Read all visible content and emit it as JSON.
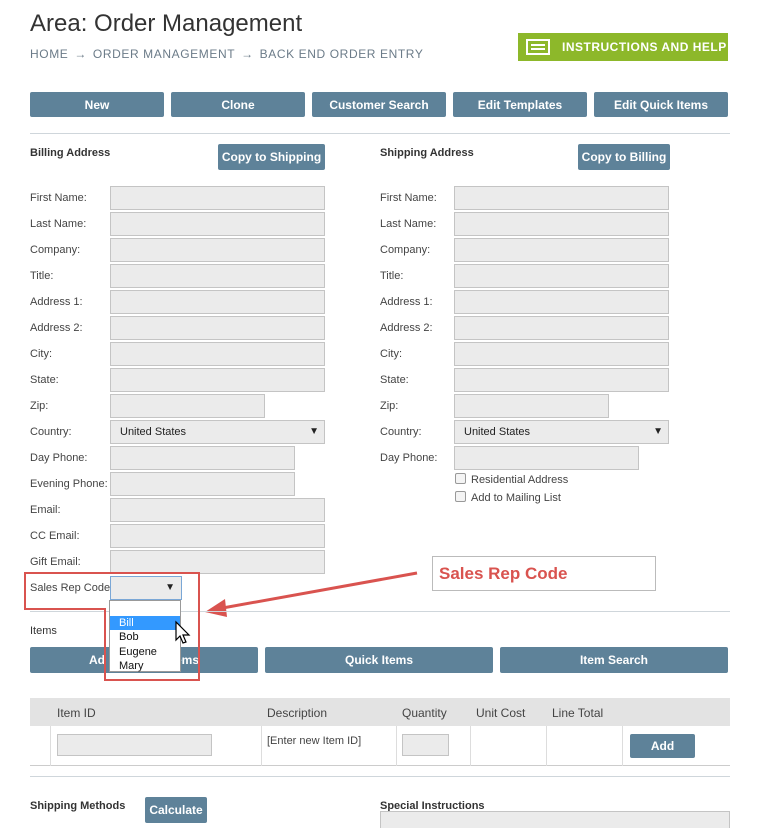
{
  "header": {
    "title": "Area: Order Management",
    "breadcrumb": [
      "HOME",
      "ORDER MANAGEMENT",
      "BACK END ORDER ENTRY"
    ],
    "breadcrumb_sep": "→",
    "help_label": "INSTRUCTIONS AND HELP"
  },
  "toolbar": {
    "new": "New",
    "clone": "Clone",
    "customer_search": "Customer Search",
    "edit_templates": "Edit Templates",
    "edit_quick_items": "Edit Quick Items"
  },
  "billing": {
    "heading": "Billing Address",
    "copy_btn": "Copy to Shipping",
    "labels": {
      "first_name": "First Name:",
      "last_name": "Last Name:",
      "company": "Company:",
      "title": "Title:",
      "address1": "Address 1:",
      "address2": "Address 2:",
      "city": "City:",
      "state": "State:",
      "zip": "Zip:",
      "country": "Country:",
      "day_phone": "Day Phone:",
      "evening_phone": "Evening Phone:",
      "email": "Email:",
      "cc_email": "CC Email:",
      "gift_email": "Gift Email:",
      "sales_rep": "Sales Rep Code"
    },
    "country_value": "United States"
  },
  "shipping": {
    "heading": "Shipping Address",
    "copy_btn": "Copy to Billing",
    "labels": {
      "first_name": "First Name:",
      "last_name": "Last Name:",
      "company": "Company:",
      "title": "Title:",
      "address1": "Address 1:",
      "address2": "Address 2:",
      "city": "City:",
      "state": "State:",
      "zip": "Zip:",
      "country": "Country:",
      "day_phone": "Day Phone:"
    },
    "country_value": "United States",
    "residential": "Residential Address",
    "mailing": "Add to Mailing List"
  },
  "sales_rep_dropdown": {
    "options": [
      "",
      "Bill",
      "Bob",
      "Eugene",
      "Mary"
    ],
    "highlighted": "Bill"
  },
  "annotation": {
    "callout": "Sales Rep Code",
    "accent": "#d9534f"
  },
  "items": {
    "heading": "Items",
    "add_items": "Add Items",
    "add_items_visible": "Ad",
    "add_items_tail": "ems",
    "quick_items": "Quick Items",
    "item_search": "Item Search",
    "columns": [
      "Item ID",
      "Description",
      "Quantity",
      "Unit Cost",
      "Line Total"
    ],
    "row_placeholder_desc": "[Enter new Item ID]",
    "add_btn": "Add"
  },
  "footer": {
    "shipping_methods": "Shipping Methods",
    "calculate": "Calculate",
    "special_instructions": "Special Instructions"
  },
  "colors": {
    "button": "#5e8299",
    "help": "#8db82a"
  }
}
